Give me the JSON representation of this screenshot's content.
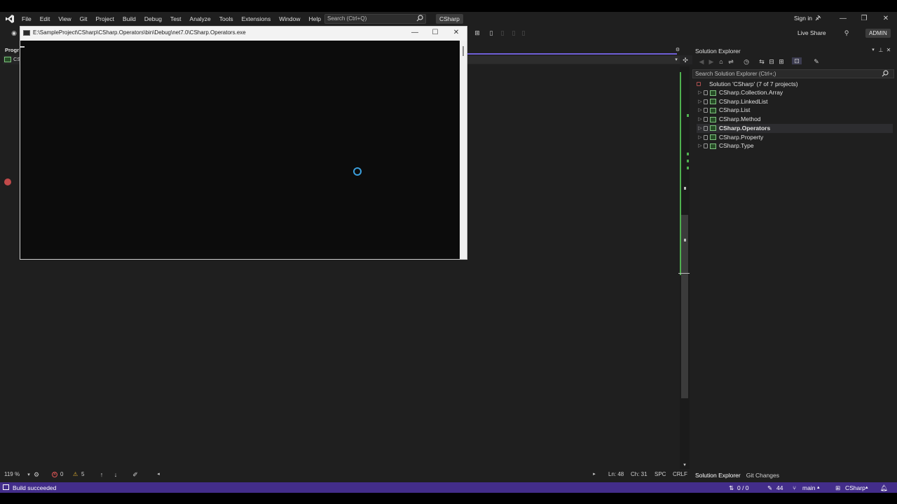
{
  "menu": [
    "File",
    "Edit",
    "View",
    "Git",
    "Project",
    "Build",
    "Debug",
    "Test",
    "Analyze",
    "Tools",
    "Extensions",
    "Window",
    "Help"
  ],
  "search": {
    "placeholder": "Search (Ctrl+Q)"
  },
  "solution_name": "CSharp",
  "account": {
    "sign_in": "Sign in",
    "live_share": "Live Share",
    "admin": "ADMIN"
  },
  "editor": {
    "tab_label": "Progr",
    "nav_label": "CS"
  },
  "console": {
    "title": "E:\\SampleProject\\CSharp\\CSharp.Operators\\bin\\Debug\\net7.0\\CSharp.Operators.exe"
  },
  "solution_explorer": {
    "title": "Solution Explorer",
    "search_placeholder": "Search Solution Explorer (Ctrl+;)",
    "root": "Solution 'CSharp' (7 of 7 projects)",
    "projects": [
      "CSharp.Collection.Array",
      "CSharp.LinkedList",
      "CSharp.List",
      "CSharp.Method",
      "CSharp.Operators",
      "CSharp.Property",
      "CSharp.Type"
    ],
    "selected_project": "CSharp.Operators",
    "tabs": [
      "Solution Explorer",
      "Git Changes"
    ]
  },
  "editor_status": {
    "zoom": "119 %",
    "errors": "0",
    "warnings": "5",
    "line": "Ln: 48",
    "col": "Ch: 31",
    "whitespace": "SPC",
    "eol": "CRLF"
  },
  "status_bar": {
    "message": "Build succeeded",
    "sync": "0 / 0",
    "changes": "44",
    "branch": "main",
    "repo": "CSharp"
  },
  "colors": {
    "status_bar": "#432d8a",
    "accent": "#6f5fd6",
    "breakpoint": "#c14a4a",
    "change_bar": "#4fb04f",
    "spinner": "#3b9fdc"
  }
}
